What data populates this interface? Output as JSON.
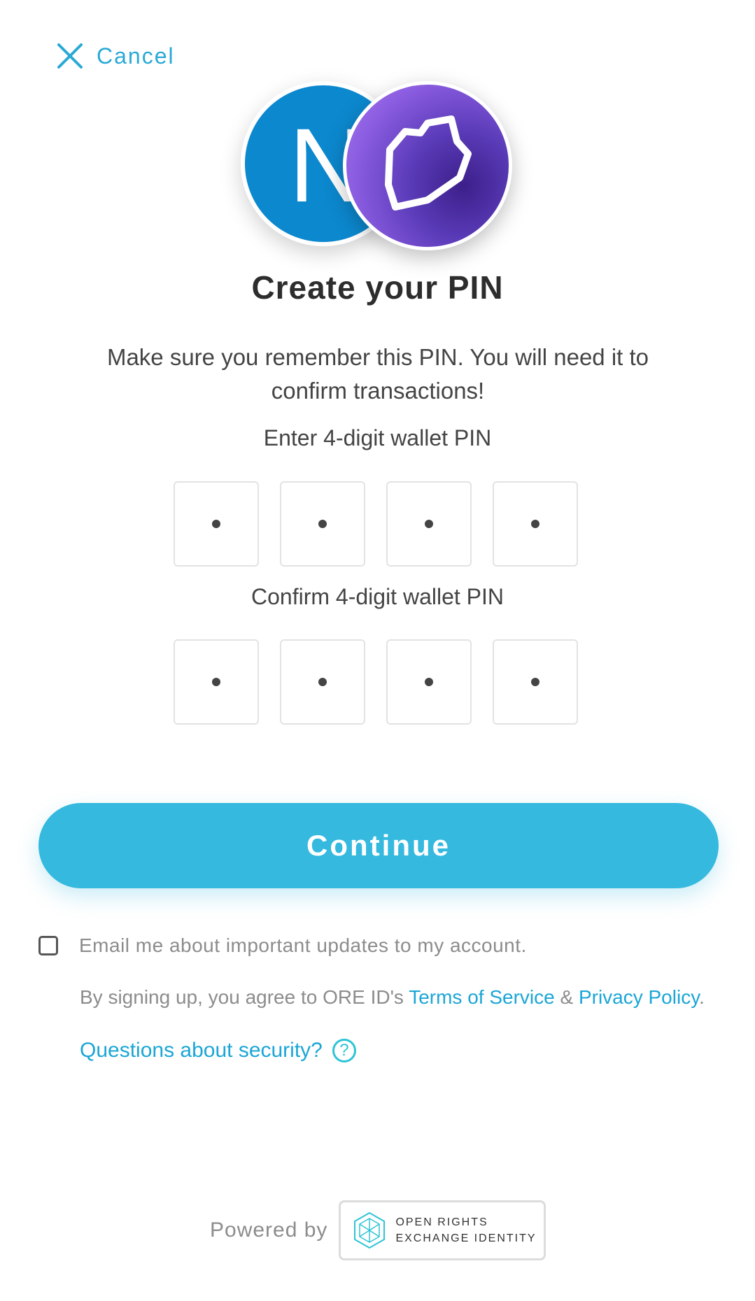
{
  "header": {
    "cancel_label": "Cancel"
  },
  "logos": {
    "left_letter": "N"
  },
  "title": "Create your PIN",
  "subtitle": "Make sure you remember this PIN. You will need it to confirm transactions!",
  "pin_entry": {
    "label": "Enter 4-digit wallet PIN",
    "digits": [
      "•",
      "•",
      "•",
      "•"
    ]
  },
  "pin_confirm": {
    "label": "Confirm 4-digit wallet PIN",
    "digits": [
      "•",
      "•",
      "•",
      "•"
    ]
  },
  "continue_label": "Continue",
  "email_opt_in": {
    "label": "Email me about important updates to my account.",
    "checked": false
  },
  "terms": {
    "prefix": "By signing up, you agree to ORE ID's ",
    "tos_link": "Terms of Service",
    "amp": " & ",
    "privacy_link": "Privacy Policy",
    "suffix": "."
  },
  "security_link": "Questions about security?",
  "security_icon_glyph": "?",
  "footer": {
    "powered_by": "Powered by",
    "badge_line1": "OPEN RIGHTS",
    "badge_line2": "EXCHANGE IDENTITY"
  },
  "colors": {
    "accent": "#35b9df",
    "link": "#1ba6d6",
    "logo_blue": "#0c88cf",
    "logo_purple": "#5a3bb8"
  }
}
